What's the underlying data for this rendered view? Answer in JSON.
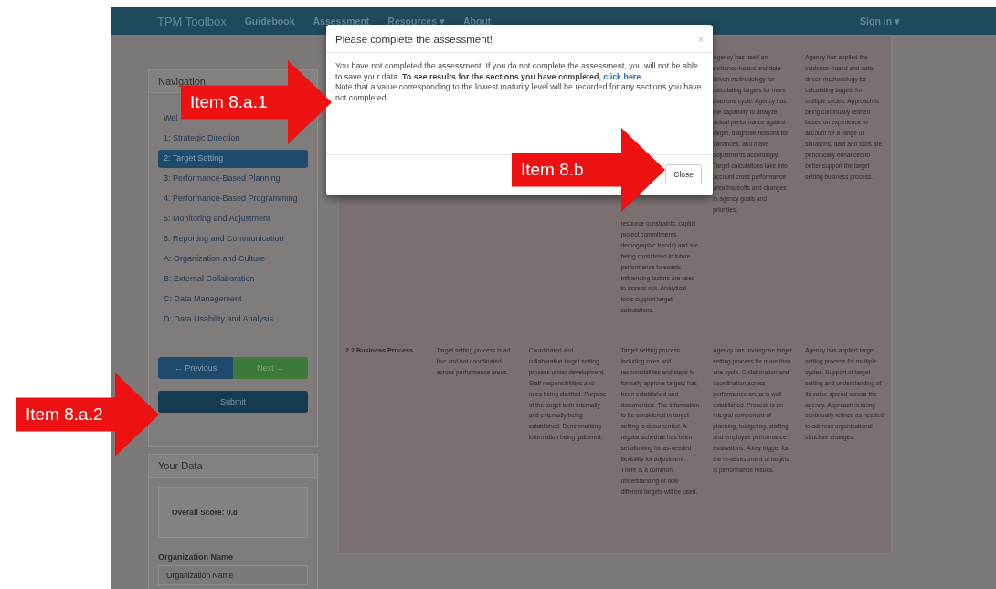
{
  "navbar": {
    "brand": "TPM Toolbox",
    "links": [
      {
        "label": "Guidebook"
      },
      {
        "label": "Assessment"
      },
      {
        "label": "Resources ▾"
      },
      {
        "label": "About"
      }
    ],
    "sign_in": "Sign in ▾"
  },
  "navigation": {
    "title": "Navigation",
    "items": [
      {
        "label": "Wel",
        "selected": false
      },
      {
        "label": "1: Strategic Direction",
        "selected": false
      },
      {
        "label": "2: Target Setting",
        "selected": true
      },
      {
        "label": "3: Performance-Based Planning",
        "selected": false
      },
      {
        "label": "4: Performance-Based Programming",
        "selected": false
      },
      {
        "label": "5: Monitoring and Adjustment",
        "selected": false
      },
      {
        "label": "6: Reporting and Communication",
        "selected": false
      },
      {
        "label": "A: Organization and Culture",
        "selected": false
      },
      {
        "label": "B: External Collaboration",
        "selected": false
      },
      {
        "label": "C: Data Management",
        "selected": false
      },
      {
        "label": "D: Data Usability and Analysis",
        "selected": false
      }
    ],
    "previous": "← Previous",
    "next": "Next →",
    "submit": "Submit"
  },
  "your_data": {
    "title": "Your Data",
    "score": "Overall Score: 0.8",
    "org_label": "Organization Name",
    "org_placeholder": "Organization Name"
  },
  "table": {
    "rows": [
      {
        "column_4": "resource constraints, capital project commitments, demographic trends) and are being considered in future performance forecasts. Influencing factors are used to assess risk. Analytical tools support target calculations.",
        "column_5": "Agency has used an evidence-based and data-driven methodology for calculating targets for more than one cycle. Agency has the capability to analyze actual performance against target, diagnose reasons for variances, and make adjustments accordingly. Target calculations take into account cross performance area tradeoffs and changes in agency goals and priorities.",
        "column_6": "Agency has applied the evidence-based and data-driven methodology for calculating targets for multiple cycles. Approach is being continually refined based on experience to account for a range of situations; data and tools are periodically enhanced to better support the target setting business process."
      },
      {
        "column_1": "2.2 Business Process",
        "column_2": "Target setting process is ad hoc and not coordinated across performance areas.",
        "column_3": "Coordinated and collaborative target setting process under development. Staff responsibilities and roles being clarified. Purpose of the target both internally and externally being established. Benchmarking information being gathered.",
        "column_4": "Target setting process including roles and responsibilities and steps to formally approve targets has been established and documented. The information to be considered in target setting is documented. A regular schedule has been set allowing for as-needed flexibility for adjustment. There is a common understanding of how different targets will be used.",
        "column_5": "Agency has undergone target setting process for more than one cycle. Collaboration and coordination across performance areas is well established. Process is an integral component of planning, budgeting, staffing, and employee performance evaluations. A key trigger for the re-assessment of targets is performance results.",
        "column_6": "Agency has applied target setting process for multiple cycles. Support of target setting and understanding of its value spread across the agency. Approach is being continually refined as needed to address organizational structure changes."
      }
    ]
  },
  "modal": {
    "title": "Please complete the assessment!",
    "close_x": "×",
    "message": "You have not completed the assessment. If you do not complete the assessment, you will not be able to save your data. **To see results for the sections you have completed,**",
    "link": "click here.",
    "note": "Note that a value corresponding to the lowest maturity level will be recorded for any sections you have not completed.",
    "close_button": "Close"
  },
  "annotations": [
    {
      "label": "Item 8.a.1"
    },
    {
      "label": "Item 8.b"
    },
    {
      "label": "Item 8.a.2"
    }
  ]
}
